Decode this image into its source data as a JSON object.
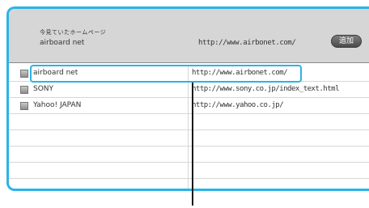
{
  "header": {
    "caption": "今見ていたホームページ",
    "current_title": "airboard net",
    "current_url": "http://www.airbonet.com/",
    "add_label": "追加"
  },
  "bookmarks": [
    {
      "title": "airboard net",
      "url": "http://www.airbonet.com/"
    },
    {
      "title": "SONY",
      "url": "http://www.sony.co.jp/index_text.html"
    },
    {
      "title": "Yahoo! JAPAN",
      "url": "http://www.yahoo.co.jp/"
    },
    {
      "title": "",
      "url": ""
    },
    {
      "title": "",
      "url": ""
    },
    {
      "title": "",
      "url": ""
    },
    {
      "title": "",
      "url": ""
    },
    {
      "title": "",
      "url": ""
    }
  ],
  "colors": {
    "accent": "#2ab4e6",
    "header_bg": "#d6d6d6",
    "button_bg": "#5a5a5a"
  }
}
